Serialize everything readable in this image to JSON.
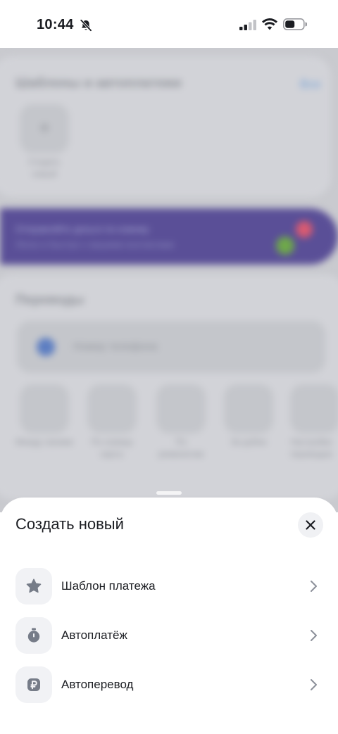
{
  "status_bar": {
    "time": "10:44",
    "icons": [
      "bell-off-icon",
      "signal-icon",
      "wifi-icon",
      "battery-icon"
    ]
  },
  "background": {
    "templates_title": "Шаблоны и автоплатежи",
    "templates_link": "Все",
    "create_tile_label": "Создать новый",
    "promo_line1": "Отправляйте деньги по-новому",
    "promo_line2": "Легко и быстро с вашими контактами",
    "transfers_title": "Переводы",
    "phone_placeholder": "Номер телефона",
    "quick_actions": [
      "Между своими",
      "По номеру карты",
      "По реквизитам",
      "За рубеж",
      "Настройки переводов"
    ]
  },
  "sheet": {
    "title": "Создать новый",
    "close_icon": "close-icon",
    "items": [
      {
        "label": "Шаблон платежа",
        "icon": "star-icon"
      },
      {
        "label": "Автоплатёж",
        "icon": "stopwatch-icon"
      },
      {
        "label": "Автоперевод",
        "icon": "ruble-icon"
      }
    ]
  },
  "colors": {
    "accent_purple": "#5a4f97",
    "icon_gray": "#767c88",
    "sheet_bg": "#ffffff",
    "overlay_bg": "#c9cacf"
  }
}
